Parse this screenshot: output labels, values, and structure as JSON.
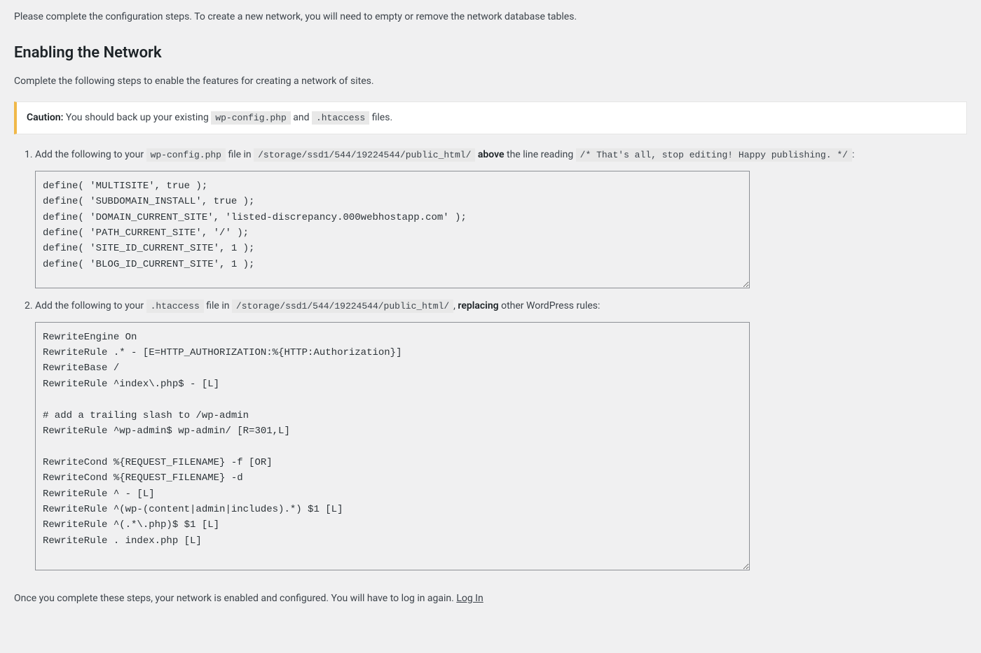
{
  "intro": "Please complete the configuration steps. To create a new network, you will need to empty or remove the network database tables.",
  "heading": "Enabling the Network",
  "subtitle": "Complete the following steps to enable the features for creating a network of sites.",
  "notice": {
    "caution_label": "Caution:",
    "pre": " You should back up your existing ",
    "file1": "wp-config.php",
    "mid": " and ",
    "file2": ".htaccess",
    "post": " files."
  },
  "step1": {
    "pre": "Add the following to your ",
    "file": "wp-config.php",
    "mid1": " file in ",
    "path": "/storage/ssd1/544/19224544/public_html/",
    "mid2": " ",
    "above": "above",
    "mid3": " the line reading ",
    "line": "/* That's all, stop editing! Happy publishing. */",
    "post": ":",
    "code": "define( 'MULTISITE', true );\ndefine( 'SUBDOMAIN_INSTALL', true );\ndefine( 'DOMAIN_CURRENT_SITE', 'listed-discrepancy.000webhostapp.com' );\ndefine( 'PATH_CURRENT_SITE', '/' );\ndefine( 'SITE_ID_CURRENT_SITE', 1 );\ndefine( 'BLOG_ID_CURRENT_SITE', 1 );"
  },
  "step2": {
    "pre": "Add the following to your ",
    "file": ".htaccess",
    "mid1": " file in ",
    "path": "/storage/ssd1/544/19224544/public_html/",
    "mid2": ", ",
    "replacing": "replacing",
    "post": " other WordPress rules:",
    "code": "RewriteEngine On\nRewriteRule .* - [E=HTTP_AUTHORIZATION:%{HTTP:Authorization}]\nRewriteBase /\nRewriteRule ^index\\.php$ - [L]\n\n# add a trailing slash to /wp-admin\nRewriteRule ^wp-admin$ wp-admin/ [R=301,L]\n\nRewriteCond %{REQUEST_FILENAME} -f [OR]\nRewriteCond %{REQUEST_FILENAME} -d\nRewriteRule ^ - [L]\nRewriteRule ^(wp-(content|admin|includes).*) $1 [L]\nRewriteRule ^(.*\\.php)$ $1 [L]\nRewriteRule . index.php [L]"
  },
  "outro": {
    "text": "Once you complete these steps, your network is enabled and configured. You will have to log in again. ",
    "link": "Log In"
  }
}
